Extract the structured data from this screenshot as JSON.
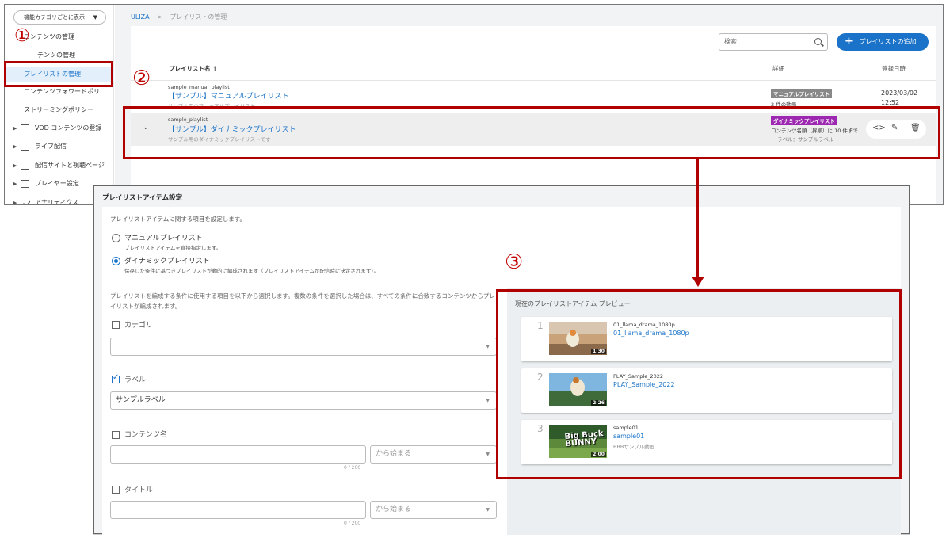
{
  "sidebar": {
    "dropdown_label": "機能カテゴリごとに表示",
    "items": [
      {
        "label": "コンテンツの管理"
      },
      {
        "label": "テンツの管理"
      },
      {
        "label": "プレイリストの管理"
      },
      {
        "label": "コンテンツフォワードポリ..."
      },
      {
        "label": "ストリーミングポリシー"
      },
      {
        "label": "VOD コンテンツの登録"
      },
      {
        "label": "ライブ配信"
      },
      {
        "label": "配信サイトと視聴ページ"
      },
      {
        "label": "プレイヤー設定"
      },
      {
        "label": "アナリティクス"
      }
    ]
  },
  "markers": {
    "one": "①",
    "two": "②",
    "three": "③"
  },
  "breadcrumb": {
    "root": "ULIZA",
    "separator": ">",
    "current": "プレイリストの管理"
  },
  "toolbar": {
    "search_placeholder": "検索",
    "add_button": "プレイリストの追加"
  },
  "table": {
    "headers": {
      "name": "プレイリスト名 ↑",
      "detail": "詳細",
      "date": "登録日時"
    },
    "rows": [
      {
        "id": "sample_manual_playlist",
        "name": "【サンプル】マニュアルプレイリスト",
        "desc": "サンプル用のマニュアルプレイリスト",
        "badge": "マニュアルプレイリスト",
        "detail": "2 件の動画",
        "date": "2023/03/02",
        "time": "12:52"
      },
      {
        "id": "sample_playlist",
        "name": "【サンプル】ダイナミックプレイリスト",
        "desc": "サンプル用のダイナミックプレイリストです",
        "badge": "ダイナミックプレイリスト",
        "detail": "コンテンツ名順（昇順）に 10 件まで",
        "detail2": "ラベル：サンプルラベル"
      }
    ]
  },
  "dialog": {
    "title": "プレイリストアイテム設定",
    "intro": "プレイリストアイテムに関する項目を設定します。",
    "options": [
      {
        "label": "マニュアルプレイリスト",
        "desc": "プレイリストアイテムを直接指定します。",
        "selected": false
      },
      {
        "label": "ダイナミックプレイリスト",
        "desc": "保存した条件に基づきプレイリストが動的に編成されます（プレイリストアイテムが配信時に決定されます）。",
        "selected": true
      }
    ],
    "conditions_intro": "プレイリストを編成する条件に使用する項目を以下から選択します。複数の条件を選択した場合は、すべての条件に合致するコンテンツからプレイリストが編成されます。",
    "conditions": {
      "category": {
        "label": "カテゴリ",
        "checked": false,
        "value": ""
      },
      "label": {
        "label": "ラベル",
        "checked": true,
        "value": "サンプルラベル"
      },
      "content_name": {
        "label": "コンテンツ名",
        "checked": false,
        "match": "から始まる",
        "counter": "0 / 200"
      },
      "title": {
        "label": "タイトル",
        "checked": false,
        "match": "から始まる",
        "counter": "0 / 200"
      }
    }
  },
  "preview": {
    "title": "現在のプレイリストアイテム プレビュー",
    "items": [
      {
        "num": "1",
        "id": "01_llama_drama_1080p",
        "name": "01_llama_drama_1080p",
        "duration": "1:30",
        "desc": ""
      },
      {
        "num": "2",
        "id": "PLAY_Sample_2022",
        "name": "PLAY_Sample_2022",
        "duration": "2:26",
        "desc": ""
      },
      {
        "num": "3",
        "id": "sample01",
        "name": "sample01",
        "duration": "2:00",
        "desc": "BBBサンプル動画"
      }
    ],
    "bunny_logo": "Big Buck BUNNY"
  },
  "colors": {
    "accent": "#1a73c8",
    "highlight_red": "#b00000",
    "dynamic_badge": "#9c27b0",
    "manual_badge": "#888888"
  }
}
